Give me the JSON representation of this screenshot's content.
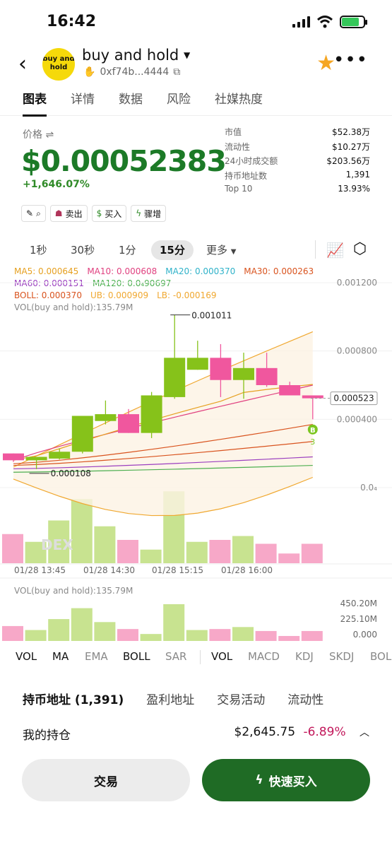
{
  "status": {
    "time": "16:42"
  },
  "header": {
    "logo_text": "buy and hold",
    "title": "buy and hold",
    "address": "0xf74b...4444"
  },
  "tabs": [
    "图表",
    "详情",
    "数据",
    "风险",
    "社媒热度"
  ],
  "price": {
    "label": "价格 ⇌",
    "value": "$0.00052383",
    "change": "+1,646.07%"
  },
  "stats": [
    {
      "label": "市值",
      "value": "$52.38万"
    },
    {
      "label": "流动性",
      "value": "$10.27万"
    },
    {
      "label": "24小时成交额",
      "value": "$203.56万"
    },
    {
      "label": "持币地址数",
      "value": "1,391"
    },
    {
      "label": "Top 10",
      "value": "13.93%"
    }
  ],
  "actions": {
    "sell": "卖出",
    "buy": "买入",
    "boost": "骤增"
  },
  "timeframes": [
    "1秒",
    "30秒",
    "1分",
    "15分",
    "更多"
  ],
  "legend": {
    "ma5": "MA5: 0.000645",
    "ma10": "MA10: 0.000608",
    "ma20": "MA20: 0.000370",
    "ma30": "MA30: 0.000263",
    "ma60": "MA60: 0.000151",
    "ma120": "MA120: 0.0₄90697",
    "boll": "BOLL: 0.000370",
    "ub": "UB: 0.000909",
    "lb": "LB: -0.000169",
    "vol": "VOL(buy and hold):135.79M"
  },
  "colors": {
    "up": "#86c21a",
    "down": "#f0579e",
    "ma5": "#e6a020",
    "ma10": "#e0407f",
    "ma20": "#2fb2c9",
    "ma30": "#d9531e",
    "ma60": "#9b3fbf",
    "ma120": "#4caf50",
    "boll": "#d9531e",
    "ub": "#f0a830"
  },
  "chart_data": {
    "type": "candlestick",
    "x_labels": [
      "01/28 13:45",
      "01/28 14:30",
      "01/28 15:15",
      "01/28 16:00"
    ],
    "y_ticks": [
      "0.001200",
      "0.000800",
      "0.000400",
      "0.0₄"
    ],
    "last_price_label": "0.000523",
    "high_label": "0.001011",
    "low_label": "0.000108",
    "marker": "B",
    "marker_sub": "3",
    "watermark": "DEX",
    "candles": [
      {
        "o": 0.0002,
        "h": 0.0002,
        "l": 0.00015,
        "c": 0.00016
      },
      {
        "o": 0.00016,
        "h": 0.00017,
        "l": 0.000108,
        "c": 0.00018
      },
      {
        "o": 0.00017,
        "h": 0.00023,
        "l": 0.000165,
        "c": 0.00021
      },
      {
        "o": 0.00021,
        "h": 0.00042,
        "l": 0.0002,
        "c": 0.00042
      },
      {
        "o": 0.00039,
        "h": 0.00051,
        "l": 0.00037,
        "c": 0.00043
      },
      {
        "o": 0.00043,
        "h": 0.00046,
        "l": 0.00032,
        "c": 0.00032
      },
      {
        "o": 0.00032,
        "h": 0.00056,
        "l": 0.00029,
        "c": 0.00054
      },
      {
        "o": 0.00053,
        "h": 0.001011,
        "l": 0.00052,
        "c": 0.00076
      },
      {
        "o": 0.00069,
        "h": 0.00086,
        "l": 0.00069,
        "c": 0.00076
      },
      {
        "o": 0.00076,
        "h": 0.00084,
        "l": 0.00053,
        "c": 0.00063
      },
      {
        "o": 0.00063,
        "h": 0.00079,
        "l": 0.00052,
        "c": 0.0007
      },
      {
        "o": 0.0007,
        "h": 0.00079,
        "l": 0.00059,
        "c": 0.0006
      },
      {
        "o": 0.0006,
        "h": 0.00062,
        "l": 0.00058,
        "c": 0.00054
      },
      {
        "o": 0.00054,
        "h": 0.00054,
        "l": 0.0004,
        "c": 0.000523
      }
    ],
    "volumes": [
      75,
      55,
      110,
      165,
      95,
      60,
      35,
      185,
      55,
      60,
      70,
      50,
      25,
      50
    ],
    "volume_unit": "M"
  },
  "volume_panel": {
    "label": "VOL(buy and hold):135.79M",
    "ticks": [
      "450.20M",
      "225.10M",
      "0.000"
    ]
  },
  "indicators": [
    "VOL",
    "MA",
    "EMA",
    "BOLL",
    "SAR",
    "VOL",
    "MACD",
    "KDJ",
    "SKDJ",
    "BOL"
  ],
  "bottom_tabs": [
    "持币地址 (1,391)",
    "盈利地址",
    "交易活动",
    "流动性"
  ],
  "holding": {
    "label": "我的持仓",
    "value": "$2,645.75",
    "change": "-6.89%"
  },
  "buttons": {
    "trade": "交易",
    "quick_buy": "快速买入"
  }
}
